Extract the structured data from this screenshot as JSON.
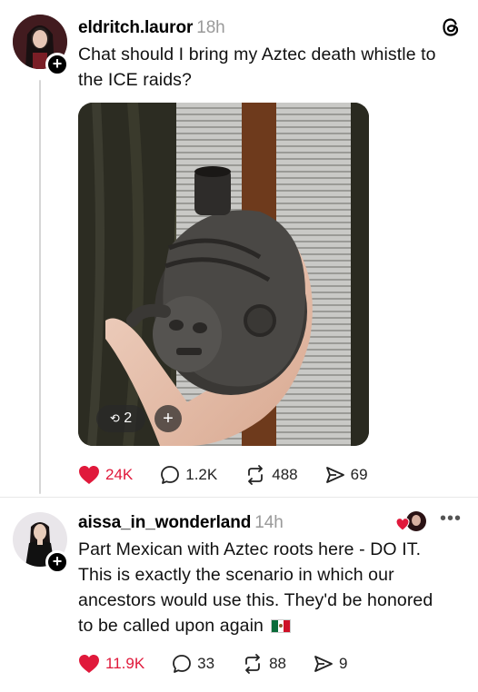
{
  "posts": [
    {
      "username": "eldritch.lauror",
      "time": "18h",
      "text_line1": "Chat should I bring my Aztec death whistle to",
      "text_line2": "the ICE raids?",
      "media": {
        "carousel_count": "2"
      },
      "actions": {
        "likes": "24K",
        "comments": "1.2K",
        "reposts": "488",
        "shares": "69"
      }
    },
    {
      "username": "aissa_in_wonderland",
      "time": "14h",
      "text_line1": "Part Mexican with Aztec roots here - DO IT.",
      "text_line2": "This is exactly the scenario in which our",
      "text_line3": "ancestors would use this. They'd be honored",
      "text_line4": "to be called upon again",
      "actions": {
        "likes": "11.9K",
        "comments": "33",
        "reposts": "88",
        "shares": "9"
      }
    }
  ],
  "icons": {
    "app_logo": "threads-icon",
    "like": "heart-icon",
    "comment": "comment-icon",
    "repost": "repost-icon",
    "share": "share-icon",
    "flag": "mexico-flag-icon"
  },
  "colors": {
    "like_red": "#e0193b",
    "muted_gray": "#9a9a9a"
  }
}
